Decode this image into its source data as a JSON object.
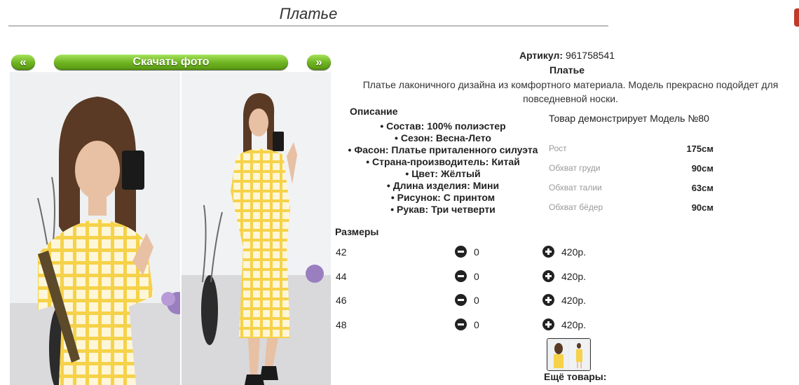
{
  "page": {
    "title": "Платье"
  },
  "gallery": {
    "prev_label": "«",
    "download_label": "Скачать фото",
    "next_label": "»"
  },
  "product": {
    "article_label": "Артикул:",
    "article_value": "961758541",
    "name": "Платье",
    "description": "Платье лаконичного дизайна из комфортного материала. Модель прекрасно подойдет для повседневной носки.",
    "description_heading": "Описание",
    "attributes": [
      "Состав: 100% полиэстер",
      "Сезон: Весна-Лето",
      "Фасон: Платье приталенного силуэта",
      "Страна-производитель: Китай",
      "Цвет: Жёлтый",
      "Длина изделия: Мини",
      "Рисунок: С принтом",
      "Рукав: Три четверти"
    ]
  },
  "model": {
    "heading": "Товар демонстрирует Модель №80",
    "measurements": [
      {
        "label": "Рост",
        "value": "175см"
      },
      {
        "label": "Обхват груди",
        "value": "90см"
      },
      {
        "label": "Обхват талии",
        "value": "63см"
      },
      {
        "label": "Обхват бёдер",
        "value": "90см"
      }
    ]
  },
  "sizes": {
    "heading": "Размеры",
    "rows": [
      {
        "size": "42",
        "qty": "0",
        "price": "420р."
      },
      {
        "size": "44",
        "qty": "0",
        "price": "420р."
      },
      {
        "size": "46",
        "qty": "0",
        "price": "420р."
      },
      {
        "size": "48",
        "qty": "0",
        "price": "420р."
      }
    ]
  },
  "more_label": "Ещё товары:",
  "colors": {
    "accent_green": "#6cb11f",
    "dress_yellow": "#f6d24a"
  }
}
